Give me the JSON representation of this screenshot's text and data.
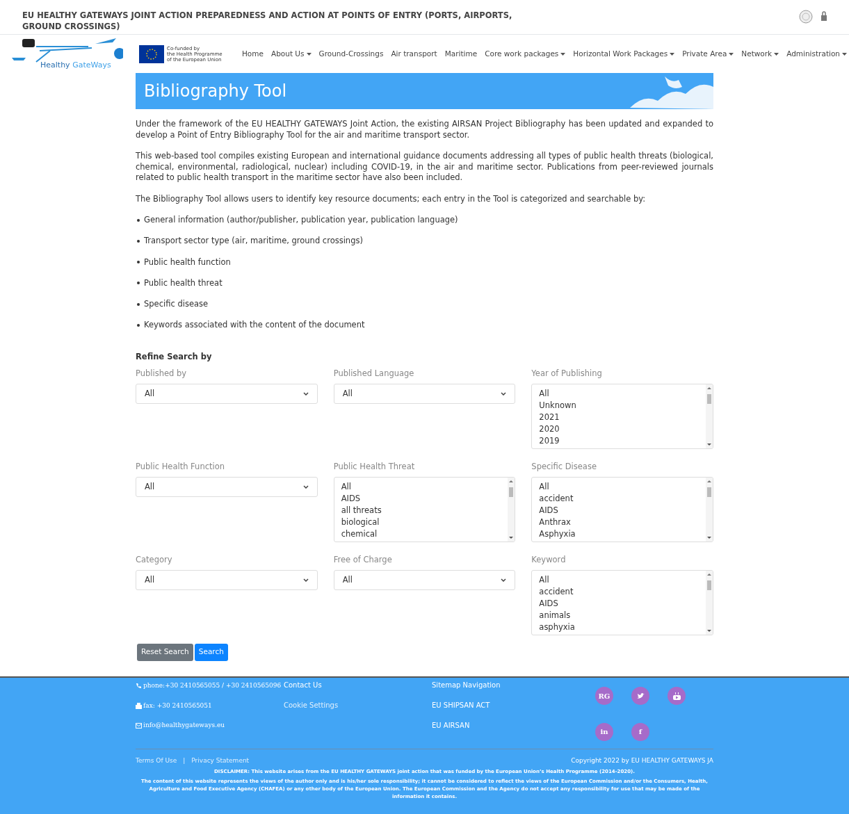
{
  "site_title": "EU HEALTHY GATEWAYS JOINT ACTION PREPAREDNESS AND ACTION AT POINTS OF ENTRY (PORTS, AIRPORTS, GROUND CROSSINGS)",
  "logo": {
    "text_a": "Healthy",
    "text_b": "GateWays"
  },
  "eu_badge": {
    "lines": [
      "Co-funded by",
      "the Health Programme",
      "of the European Union"
    ]
  },
  "nav": [
    {
      "label": "Home",
      "dropdown": false
    },
    {
      "label": "About Us",
      "dropdown": true
    },
    {
      "label": "Ground-Crossings",
      "dropdown": false
    },
    {
      "label": "Air transport",
      "dropdown": false
    },
    {
      "label": "Maritime",
      "dropdown": false
    },
    {
      "label": "Core work packages",
      "dropdown": true
    },
    {
      "label": "Horizontal Work Packages",
      "dropdown": true
    },
    {
      "label": "Private Area",
      "dropdown": true
    },
    {
      "label": "Network",
      "dropdown": true
    },
    {
      "label": "Administration",
      "dropdown": true
    }
  ],
  "banner": {
    "title": "Bibliography Tool"
  },
  "paragraphs": [
    "Under the framework of the EU HEALTHY GATEWAYS Joint Action, the existing AIRSAN Project Bibliography has been updated and expanded to develop a Point of Entry Bibliography Tool for the air and maritime transport sector.",
    "This web-based tool compiles existing European and international guidance documents addressing all types of public health threats (biological, chemical, environmental, radiological, nuclear) including COVID-19, in the air and maritime sector. Publications from peer-reviewed journals related to public health transport in the maritime sector have also been included.",
    "The Bibliography Tool allows users to identify key resource documents; each entry in the Tool is categorized and searchable by:"
  ],
  "bullets": [
    "General information (author/publisher, publication year, publication language)",
    "Transport sector type (air, maritime, ground crossings)",
    "Public health function",
    "Public health threat",
    "Specific disease",
    "Keywords associated with the content of the document"
  ],
  "refine": {
    "heading": "Refine Search by",
    "filters": [
      {
        "kind": "select",
        "label": "Published by",
        "value": "All"
      },
      {
        "kind": "select",
        "label": "Published Language",
        "value": "All"
      },
      {
        "kind": "listbox",
        "label": "Year of Publishing",
        "options": [
          "All",
          "Unknown",
          "2021",
          "2020",
          "2019"
        ]
      },
      {
        "kind": "select",
        "label": "Public Health Function",
        "value": "All"
      },
      {
        "kind": "listbox",
        "label": "Public Health Threat",
        "options": [
          "All",
          "AIDS",
          "all threats",
          "biological",
          "chemical"
        ]
      },
      {
        "kind": "listbox",
        "label": "Specific Disease",
        "options": [
          "All",
          "accident",
          "AIDS",
          "Anthrax",
          "Asphyxia"
        ]
      },
      {
        "kind": "select",
        "label": "Category",
        "value": "All"
      },
      {
        "kind": "select",
        "label": "Free of Charge",
        "value": "All"
      },
      {
        "kind": "listbox",
        "label": "Keyword",
        "options": [
          "All",
          "accident",
          "AIDS",
          "animals",
          "asphyxia"
        ]
      }
    ],
    "buttons": [
      {
        "label": "Reset Search",
        "kind": "secondary"
      },
      {
        "label": "Search",
        "kind": "primary"
      }
    ]
  },
  "footer": {
    "contacts": [
      {
        "kind": "phone",
        "text": "phone:+30 2410565055 / +30 2410565096"
      },
      {
        "kind": "fax",
        "text": "fax: +30 2410565051"
      },
      {
        "kind": "email",
        "text": "info@healthygateways.eu"
      }
    ],
    "links_a": [
      "Contact Us",
      "Cookie Settings"
    ],
    "links_b": [
      "Sitemap Navigation",
      "EU SHIPSAN ACT",
      "EU AIRSAN"
    ],
    "social": [
      {
        "kind": "text",
        "label": "RG"
      },
      {
        "kind": "twitter"
      },
      {
        "kind": "youtube"
      },
      {
        "kind": "text",
        "label": "in"
      },
      {
        "kind": "text",
        "label": "f"
      }
    ],
    "legal": [
      "Terms Of Use",
      "|",
      "Privacy Statement"
    ],
    "copyright": "Copyright 2022 by EU HEALTHY GATEWAYS JA",
    "disclaimer": [
      "DISCLAIMER: This website arises from the EU HEALTHY GATEWAYS joint action that was funded by the European Union’s Health Programme (2014-2020).",
      "The content of this website represents the views of the author only and is his/her sole responsibility; it cannot be considered to reflect the views of the European Commission and/or the Consumers, Health, Agriculture and Food Executive Agency (CHAFEA) or any other body of the European Union. The European Commission and the Agency do not accept any responsibility for use that may be made of the information it contains."
    ]
  }
}
